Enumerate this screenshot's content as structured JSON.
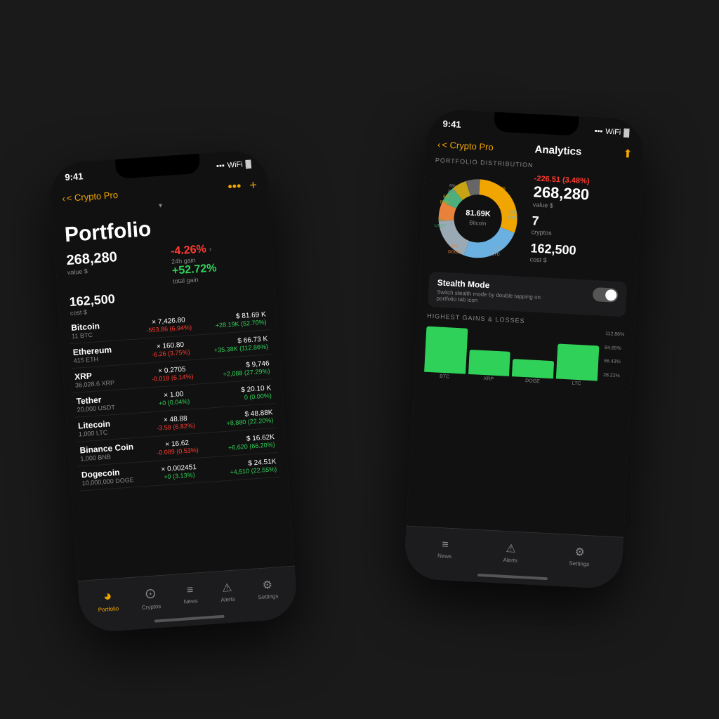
{
  "leftPhone": {
    "statusTime": "9:41",
    "navBack": "< Crypto Pro",
    "portfolioTitle": "Portfolio",
    "value": "268,280",
    "valueLabel": "value $",
    "cost": "162,500",
    "costLabel": "cost $",
    "change24h": "-4.26%",
    "change24hLabel": "24h gain",
    "totalGain": "+52.72%",
    "totalGainLabel": "total gain",
    "cryptos": [
      {
        "name": "Bitcoin",
        "amount": "11 BTC",
        "price": "× 7,426.80",
        "change": "-553.86 (6.94%)",
        "changeType": "red",
        "value": "$ 81.69 K",
        "gain": "+28.19K (52.70%)",
        "gainType": "green"
      },
      {
        "name": "Ethereum",
        "amount": "415 ETH",
        "price": "× 160.80",
        "change": "-6.26 (3.75%)",
        "changeType": "red",
        "value": "$ 66.73 K",
        "gain": "+35.38K (112.86%)",
        "gainType": "green"
      },
      {
        "name": "XRP",
        "amount": "36,028.6 XRP",
        "price": "× 0.2705",
        "change": "-0.018 (6.14%)",
        "changeType": "red",
        "value": "$ 9,746",
        "gain": "+2,088 (27.29%)",
        "gainType": "green"
      },
      {
        "name": "Tether",
        "amount": "20,000 USDT",
        "price": "× 1.00",
        "change": "+0 (0.04%)",
        "changeType": "green",
        "value": "$ 20.10 K",
        "gain": "0 (0.00%)",
        "gainType": "green"
      },
      {
        "name": "Litecoin",
        "amount": "1,000 LTC",
        "price": "× 48.88",
        "change": "-3.58 (6.82%)",
        "changeType": "red",
        "value": "$ 48.88K",
        "gain": "+8,880 (22.20%)",
        "gainType": "green"
      },
      {
        "name": "Binance Coin",
        "amount": "1,000 BNB",
        "price": "× 16.62",
        "change": "-0.089 (0.53%)",
        "changeType": "red",
        "value": "$ 16.62K",
        "gain": "+6,620 (66.20%)",
        "gainType": "green"
      },
      {
        "name": "Dogecoin",
        "amount": "10,000,000 DOGE",
        "price": "× 0.002451",
        "change": "+0 (3.13%)",
        "changeType": "green",
        "value": "$ 24.51K",
        "gain": "+4,510 (22.55%)",
        "gainType": "green"
      }
    ],
    "tabs": [
      {
        "label": "Portfolio",
        "active": true,
        "icon": "●"
      },
      {
        "label": "Cryptos",
        "active": false,
        "icon": "⊙"
      },
      {
        "label": "News",
        "active": false,
        "icon": "≡"
      },
      {
        "label": "Alerts",
        "active": false,
        "icon": "⚠"
      },
      {
        "label": "Settings",
        "active": false,
        "icon": "⚙"
      }
    ]
  },
  "rightPhone": {
    "statusTime": "9:41",
    "navBack": "< Crypto Pro",
    "navTitle": "Analytics",
    "sectionTitle": "PORTFOLIO DISTRIBUTION",
    "donutCenter": "81.69K",
    "donutCenterLabel": "Bitcoin",
    "donutSegments": [
      {
        "label": "30% BTC",
        "color": "#f0a500",
        "pct": 30
      },
      {
        "label": "25% ETH",
        "color": "#6ab0e0",
        "pct": 25
      },
      {
        "label": "18% LTC",
        "color": "#9aaab4",
        "pct": 18
      },
      {
        "label": "8% DOGE",
        "color": "#e8823a",
        "pct": 8
      },
      {
        "label": "7% USDT",
        "color": "#4caf7d",
        "pct": 7
      },
      {
        "label": "6% BNB",
        "color": "#c8a415",
        "pct": 6
      },
      {
        "label": "6% XRP",
        "color": "#777",
        "pct": 6
      }
    ],
    "statsChange": "-226.51 (3.48%)",
    "statsValue": "268,280",
    "statsValueLabel": "value $",
    "statsCryptos": "7",
    "statsCryptosLabel": "cryptos",
    "statsCost": "162,500",
    "statsCostLabel": "cost $",
    "stealthTitle": "Stealth Mode",
    "stealthDesc": "Switch stealth mode by double tapping on portfolio tab icon",
    "gainsTitle": "HIGHEST GAINS & LOSSES",
    "barChart": [
      {
        "label": "BTC",
        "greenHeight": 60,
        "darkHeight": 50
      },
      {
        "label": "XRP",
        "greenHeight": 40,
        "darkHeight": 50
      },
      {
        "label": "DOGE",
        "greenHeight": 45,
        "darkHeight": 50
      },
      {
        "label": "LTC",
        "greenHeight": 55,
        "darkHeight": 50
      }
    ],
    "yLabels": [
      "112.86%",
      "84.65%",
      "56.43%",
      "28.22%"
    ],
    "tabs": [
      {
        "label": "News",
        "active": false,
        "icon": "≡"
      },
      {
        "label": "Alerts",
        "active": false,
        "icon": "⚠"
      },
      {
        "label": "Settings",
        "active": false,
        "icon": "⚙"
      }
    ]
  }
}
